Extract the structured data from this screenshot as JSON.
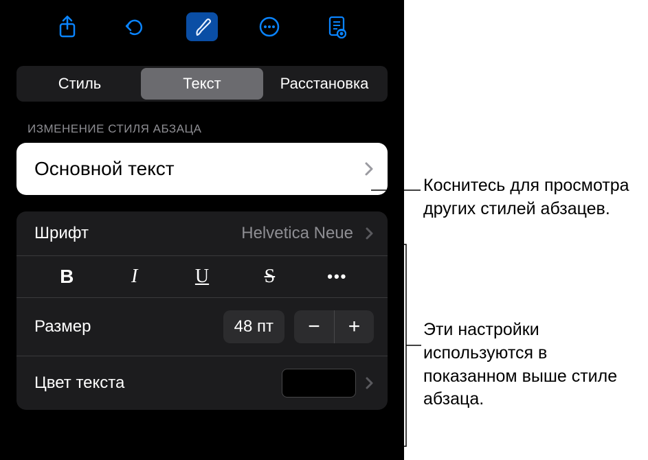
{
  "toolbar": {
    "icons": [
      "share-icon",
      "undo-icon",
      "brush-icon",
      "more-icon",
      "document-icon"
    ]
  },
  "segments": {
    "style": "Стиль",
    "text": "Текст",
    "layout": "Расстановка"
  },
  "section_label": "ИЗМЕНЕНИЕ СТИЛЯ АБЗАЦА",
  "paragraph_style": "Основной текст",
  "font": {
    "label": "Шрифт",
    "value": "Helvetica Neue"
  },
  "format_buttons": {
    "bold": "B",
    "italic": "I",
    "underline": "U",
    "strike": "S",
    "more": "•••"
  },
  "size": {
    "label": "Размер",
    "value": "48 пт",
    "minus": "−",
    "plus": "+"
  },
  "text_color": {
    "label": "Цвет текста"
  },
  "callouts": {
    "c1": "Коснитесь для просмотра других стилей абзацев.",
    "c2": "Эти настройки используются в показанном выше стиле абзаца."
  }
}
